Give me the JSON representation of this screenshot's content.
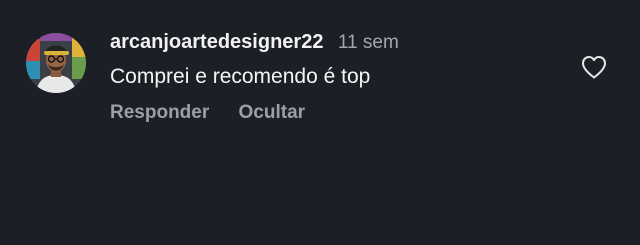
{
  "comment": {
    "username": "arcanjoartedesigner22",
    "time": "11 sem",
    "text": "Comprei e recomendo é top",
    "actions": {
      "reply_label": "Responder",
      "hide_label": "Ocultar"
    },
    "like_icon": "heart-outline-icon"
  },
  "colors": {
    "background": "#1c1f26",
    "primary_text": "#f5f5f5",
    "secondary_text": "#a3a7ae"
  }
}
